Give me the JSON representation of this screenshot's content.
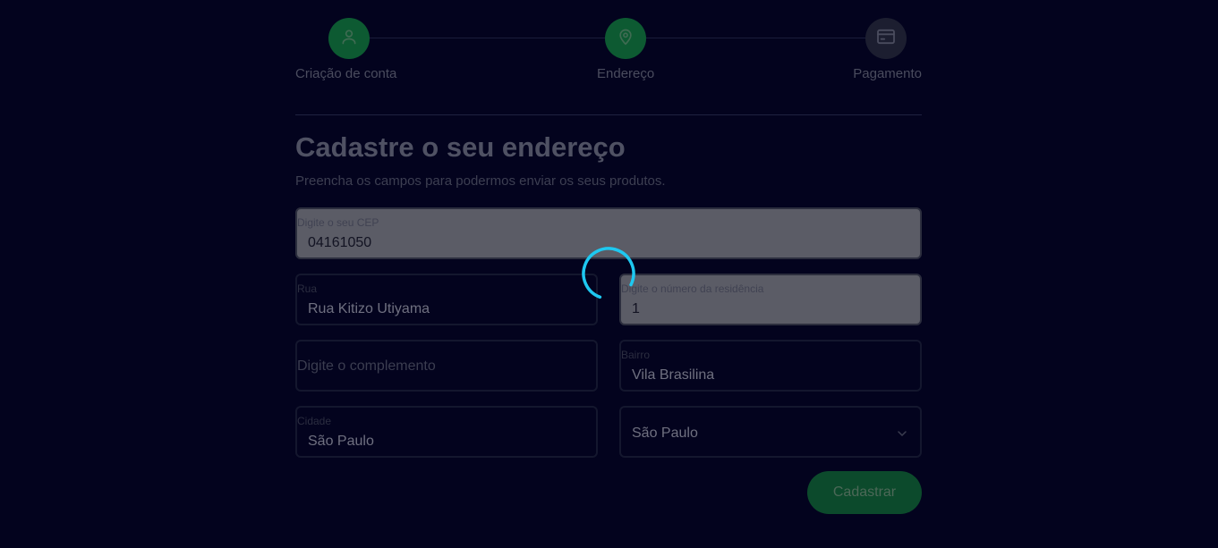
{
  "stepper": {
    "steps": [
      {
        "label": "Criação de conta",
        "icon": "user-icon",
        "state": "active"
      },
      {
        "label": "Endereço",
        "icon": "location-pin-icon",
        "state": "active"
      },
      {
        "label": "Pagamento",
        "icon": "credit-card-icon",
        "state": "inactive"
      }
    ]
  },
  "header": {
    "title": "Cadastre o seu endereço",
    "subtitle": "Preencha os campos para podermos enviar os seus produtos."
  },
  "form": {
    "cep": {
      "label": "Digite o seu CEP",
      "value": "04161050"
    },
    "rua": {
      "label": "Rua",
      "value": "Rua Kitizo Utiyama"
    },
    "numero": {
      "label": "Digite o número da residência",
      "value": "1"
    },
    "complemento": {
      "placeholder": "Digite o complemento"
    },
    "bairro": {
      "label": "Bairro",
      "value": "Vila Brasilina"
    },
    "cidade": {
      "label": "Cidade",
      "value": "São Paulo"
    },
    "estado": {
      "value": "São Paulo"
    },
    "submit_label": "Cadastrar"
  },
  "colors": {
    "background": "#03031e",
    "accent": "#0d5a32",
    "spinner": "#1ec8f0"
  }
}
